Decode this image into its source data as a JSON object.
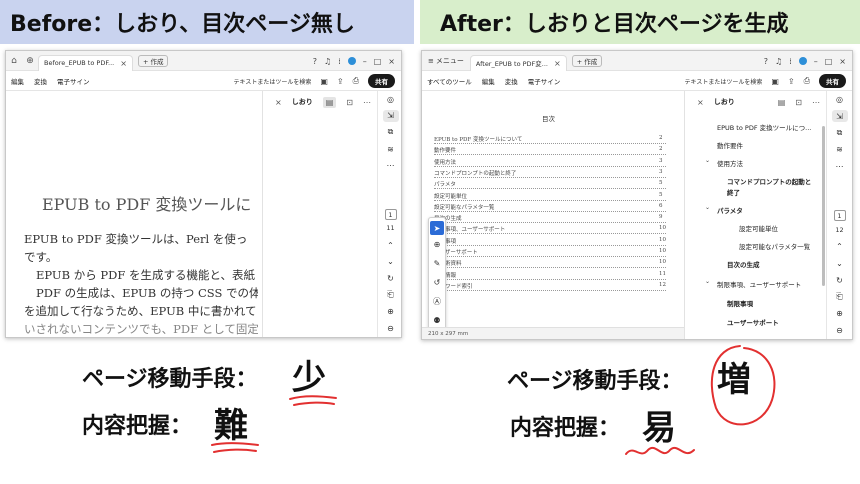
{
  "banners": {
    "before": "Before：しおり、目次ページ無し",
    "after": "After：しおりと目次ページを生成"
  },
  "before_window": {
    "tab_title": "Before_EPUB to PDF...",
    "new_tab": "+ 作成",
    "toolbar_items": [
      "編集",
      "変換",
      "電子サイン"
    ],
    "search_label": "テキストまたはツールを検索",
    "share_label": "共有",
    "panel_title": "しおり",
    "page_number": "1",
    "page_total": "11",
    "doc_heading": "EPUB to PDF 変換ツールに",
    "doc_lines": [
      "EPUB to PDF 変換ツールは、Perl を使っ",
      "です。",
      "EPUB から PDF を生成する機能と、表紙",
      "PDF の生成は、EPUB の持つ CSS での体",
      "を追加して行なうため、EPUB 中に書かれて",
      "いされないコンテンツでも、PDF として固定"
    ]
  },
  "after_window": {
    "menu_label": "メニュー",
    "tab_title": "After_EPUB to PDF変...",
    "new_tab": "+ 作成",
    "toolbar_items": [
      "すべてのツール",
      "編集",
      "変換",
      "電子サイン"
    ],
    "search_label": "テキストまたはツールを検索",
    "share_label": "共有",
    "panel_title": "しおり",
    "page_number": "1",
    "page_total": "12",
    "page_size": "210 x 297 mm",
    "toc_title": "目次",
    "toc_entries": [
      {
        "text": "EPUB to PDF 変換ツールについて",
        "page": "2"
      },
      {
        "text": "動作要件",
        "page": "2"
      },
      {
        "text": "使用方法",
        "page": "3"
      },
      {
        "text": "コマンドプロンプトの起動と終了",
        "page": "3"
      },
      {
        "text": "パラメタ",
        "page": "5"
      },
      {
        "text": "設定可能単位",
        "page": "5"
      },
      {
        "text": "設定可能なパラメタ一覧",
        "page": "6"
      },
      {
        "text": "目次の生成",
        "page": "9"
      },
      {
        "text": "制限事項、ユーザーサポート",
        "page": "10"
      },
      {
        "text": "制限事項",
        "page": "10"
      },
      {
        "text": "ユーザーサポート",
        "page": "10"
      },
      {
        "text": "他技術資料",
        "page": "10"
      },
      {
        "text": "更新情報",
        "page": "11"
      },
      {
        "text": "キーワード索引",
        "page": "12"
      }
    ],
    "bookmarks": [
      {
        "text": "EPUB to PDF 変換ツールにつ...",
        "bold": false,
        "chevron": ""
      },
      {
        "text": "動作要件",
        "bold": false,
        "chevron": ""
      },
      {
        "text": "使用方法",
        "bold": false,
        "chevron": "⌄"
      },
      {
        "text": "コマンドプロンプトの起動と",
        "bold": true,
        "chevron": ""
      },
      {
        "text": "終了",
        "bold": true,
        "chevron": ""
      },
      {
        "text": "パラメタ",
        "bold": true,
        "chevron": "⌄"
      },
      {
        "text": "設定可能単位",
        "bold": false,
        "chevron": ""
      },
      {
        "text": "設定可能なパラメタ一覧",
        "bold": false,
        "chevron": ""
      },
      {
        "text": "目次の生成",
        "bold": true,
        "chevron": ""
      },
      {
        "text": "制限事項、ユーザーサポート",
        "bold": false,
        "chevron": "⌄"
      },
      {
        "text": "制限事項",
        "bold": true,
        "chevron": ""
      },
      {
        "text": "ユーザーサポート",
        "bold": true,
        "chevron": ""
      }
    ]
  },
  "captions": {
    "before_nav_label": "ページ移動手段：",
    "before_nav_value": "少",
    "before_grasp_label": "内容把握：",
    "before_grasp_value": "難",
    "after_nav_label": "ページ移動手段：",
    "after_nav_value": "増",
    "after_grasp_label": "内容把握：",
    "after_grasp_value": "易"
  },
  "colors": {
    "before_banner": "#c9d3ef",
    "after_banner": "#d8eecb",
    "accent_red": "#e23030",
    "selected_tool": "#2b6bd6"
  }
}
